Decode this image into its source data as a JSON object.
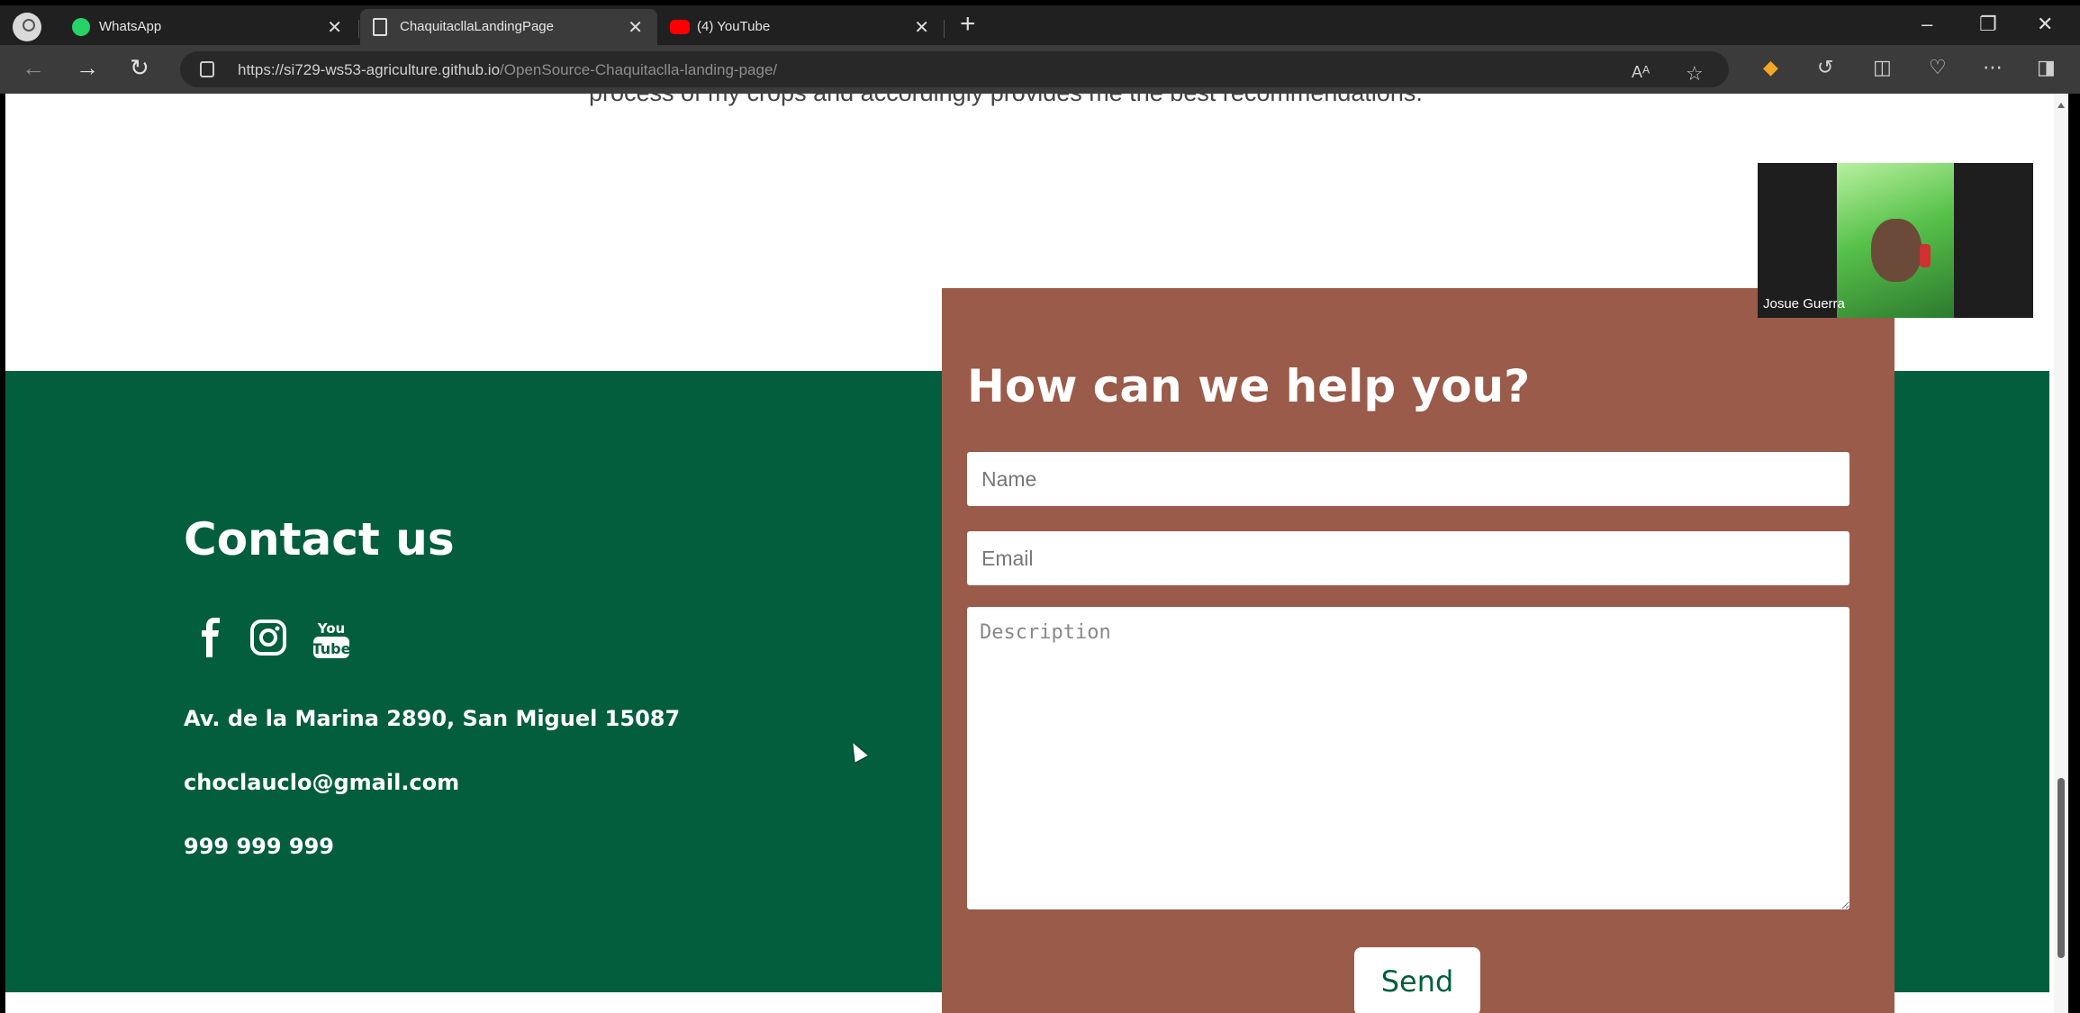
{
  "browser": {
    "tabs": [
      {
        "title": "WhatsApp",
        "active": false
      },
      {
        "title": "ChaquitacllaLandingPage",
        "active": true
      },
      {
        "title": "(4) YouTube",
        "active": false
      }
    ],
    "url": {
      "host": "https://si729-ws53-agriculture.github.io",
      "path": "/OpenSource-Chaquitaclla-landing-page/"
    },
    "icons": [
      "back-icon",
      "forward-icon",
      "reload-icon",
      "lock-icon",
      "read-aloud-icon",
      "favorite-icon",
      "extension-icon",
      "copilot-icon",
      "split-screen-icon",
      "collections-icon",
      "more-icon",
      "sidebar-icon"
    ]
  },
  "page": {
    "cut_text": "process of my crops and accordingly provides me the best recommendations.",
    "contact": {
      "title": "Contact us",
      "social_icons": [
        "facebook-icon",
        "instagram-icon",
        "youtube-icon"
      ],
      "address": "Av. de la Marina 2890, San Miguel 15087",
      "email": "choclauclo@gmail.com",
      "phone": "999 999 999"
    },
    "form": {
      "title": "How can we help you?",
      "name_placeholder": "Name",
      "email_placeholder": "Email",
      "description_placeholder": "Description",
      "send_label": "Send"
    },
    "colors": {
      "contact_background": "#035e3e",
      "form_background": "#9a5b4a"
    }
  },
  "overlay": {
    "participant_name": "Josue Guerra"
  }
}
